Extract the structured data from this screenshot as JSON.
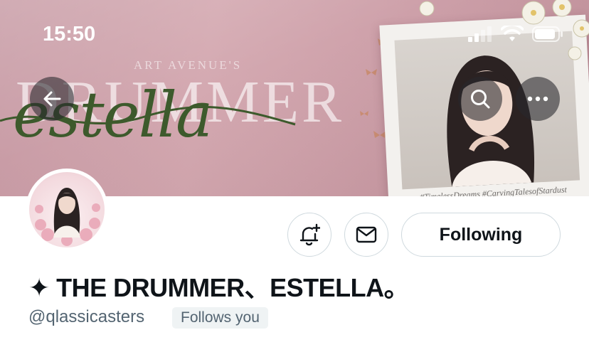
{
  "status_bar": {
    "time": "15:50"
  },
  "header": {
    "back_icon": "arrow-left-icon",
    "search_icon": "search-icon",
    "more_icon": "more-horizontal-icon"
  },
  "banner": {
    "subtitle": "ART AVENUE'S",
    "big_word": "DRUMMER",
    "script_word": "estella",
    "hashtags": "#TimelessDreams  #CarvingTalesofStardust"
  },
  "profile": {
    "display_name": "✦ THE DRUMMER、ESTELLA。",
    "handle": "@qlassicasters",
    "follows_you": "Follows you"
  },
  "actions": {
    "notify_icon": "bell-plus-icon",
    "message_icon": "envelope-icon",
    "following_label": "Following"
  },
  "colors": {
    "banner_pink": "#cfa2ab",
    "script_green": "#3d5a2c",
    "text_primary": "#0f1419",
    "text_secondary": "#536471",
    "border": "#cfd9de"
  }
}
